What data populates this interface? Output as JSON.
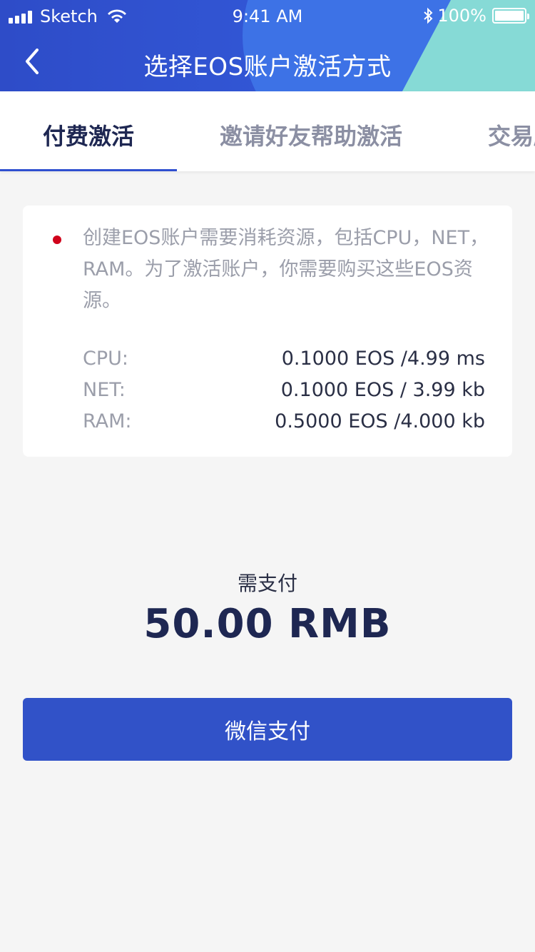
{
  "status_bar": {
    "carrier": "Sketch",
    "time": "9:41 AM",
    "battery": "100%"
  },
  "nav": {
    "title": "选择EOS账户激活方式",
    "back_icon": "chevron-left-icon"
  },
  "tabs": [
    {
      "label": "付费激活",
      "active": true
    },
    {
      "label": "邀请好友帮助激活",
      "active": false
    },
    {
      "label": "交易所",
      "active": false
    }
  ],
  "card": {
    "description": "创建EOS账户需要消耗资源，包括CPU，NET，RAM。为了激活账户，你需要购买这些EOS资源。",
    "resources": [
      {
        "label": "CPU:",
        "value": "0.1000 EOS /4.99 ms"
      },
      {
        "label": "NET:",
        "value": "0.1000 EOS / 3.99 kb"
      },
      {
        "label": "RAM:",
        "value": "0.5000 EOS /4.000 kb"
      }
    ]
  },
  "payment": {
    "label": "需支付",
    "amount": "50.00 RMB",
    "button_label": "微信支付"
  },
  "colors": {
    "header_blue": "#2f4fd0",
    "header_teal": "#86dad6",
    "button_blue": "#3152c8",
    "dot_red": "#d0021b",
    "active_text": "#1e2752"
  }
}
